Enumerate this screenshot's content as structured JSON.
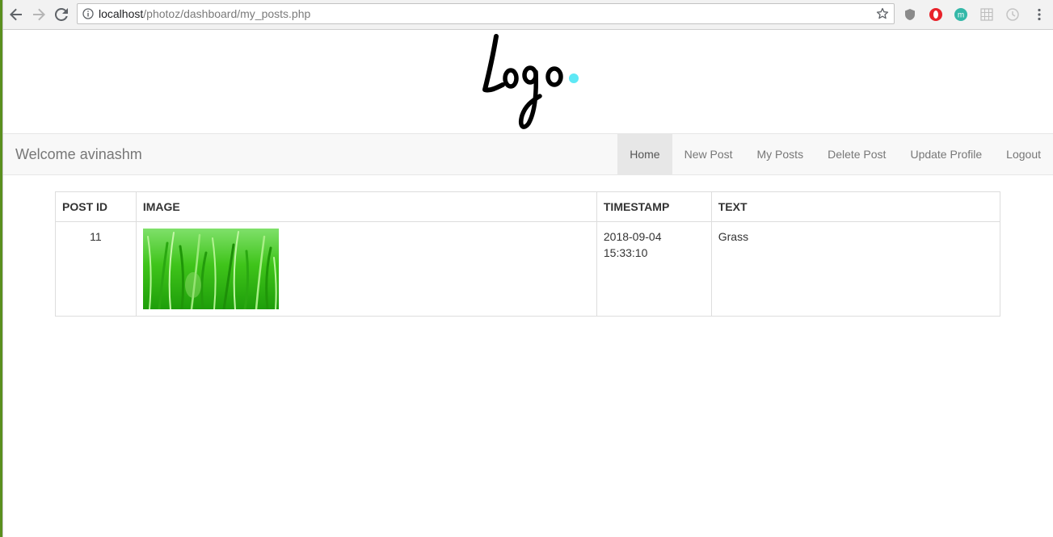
{
  "browser": {
    "url_host": "localhost",
    "url_path": "/photoz/dashboard/my_posts.php",
    "icons": [
      "back-arrow-icon",
      "forward-arrow-icon",
      "reload-icon",
      "info-icon",
      "star-icon",
      "shield-extension-icon",
      "opera-extension-icon",
      "m-extension-icon",
      "grid-extension-icon",
      "clock-extension-icon",
      "kebab-menu-icon"
    ]
  },
  "header": {
    "logo_text": "Logo",
    "logo_dot_color": "#5ee8f5"
  },
  "navbar": {
    "brand": "Welcome avinashm",
    "items": [
      {
        "label": "Home",
        "active": true
      },
      {
        "label": "New Post",
        "active": false
      },
      {
        "label": "My Posts",
        "active": false
      },
      {
        "label": "Delete Post",
        "active": false
      },
      {
        "label": "Update Profile",
        "active": false
      },
      {
        "label": "Logout",
        "active": false
      }
    ]
  },
  "table": {
    "headers": [
      "POST ID",
      "IMAGE",
      "TIMESTAMP",
      "TEXT"
    ],
    "rows": [
      {
        "post_id": "11",
        "image": "grass photo",
        "timestamp_date": "2018-09-04",
        "timestamp_time": "15:33:10",
        "text": "Grass"
      }
    ]
  },
  "colors": {
    "navbar_bg": "#f8f8f8",
    "active_nav_bg": "#e7e7e7",
    "grass_green": "#3fc41a"
  }
}
